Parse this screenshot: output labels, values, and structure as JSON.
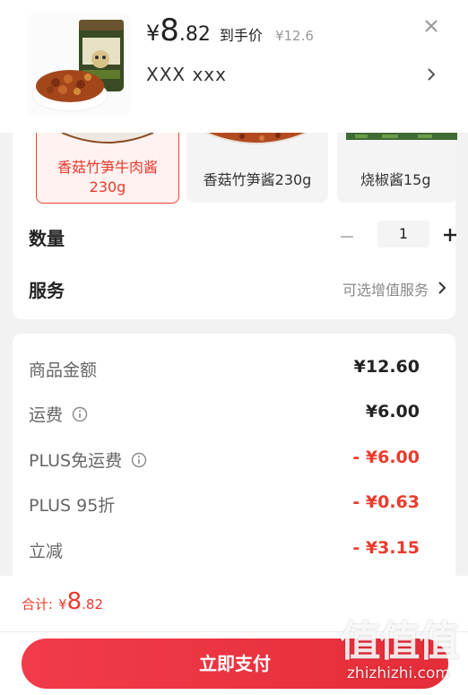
{
  "header": {
    "price_symbol": "¥",
    "price_int": "8",
    "price_dec": ".82",
    "price_tag": "到手价",
    "original_price": "¥12.6",
    "selected_variant_text": "XXX  xxx",
    "close_icon": "close-icon",
    "chevron_icon": "chevron-right-icon"
  },
  "options": [
    {
      "label": "香菇竹笋牛肉酱\n230g",
      "selected": true
    },
    {
      "label": "香菇竹笋酱230g",
      "selected": false
    },
    {
      "label": "烧椒酱15g",
      "selected": false
    }
  ],
  "quantity": {
    "label": "数量",
    "value": "1",
    "minus_icon": "minus-icon",
    "plus_icon": "plus-icon"
  },
  "service": {
    "label": "服务",
    "value": "可选增值服务"
  },
  "fees": [
    {
      "label": "商品金额",
      "value": "¥12.60",
      "info": false,
      "red": false
    },
    {
      "label": "运费",
      "value": "¥6.00",
      "info": true,
      "red": false
    },
    {
      "label": "PLUS免运费",
      "value": "- ¥6.00",
      "info": true,
      "red": true
    },
    {
      "label": "PLUS 95折",
      "value": "- ¥0.63",
      "info": false,
      "red": true
    },
    {
      "label": "立减",
      "value": "- ¥3.15",
      "info": false,
      "red": true
    }
  ],
  "footer": {
    "total_label": "合计:",
    "total_symbol": "¥",
    "total_int": "8",
    "total_dec": ".82",
    "pay_label": "立即支付"
  },
  "watermark": {
    "big": "值值值",
    "small": "zhizhizhi.com"
  },
  "colors": {
    "accent": "#e93b2d",
    "button": "#ec3440"
  }
}
